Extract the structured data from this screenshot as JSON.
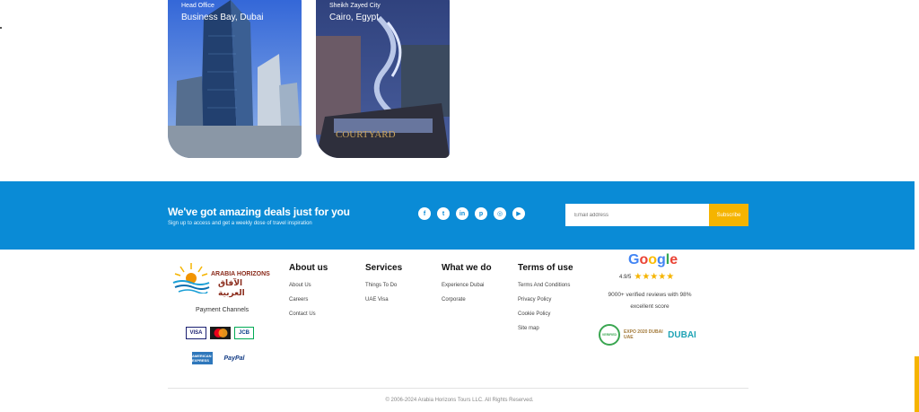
{
  "offices": [
    {
      "label": "Head Office",
      "city": "Business Bay, Dubai"
    },
    {
      "label": "Sheikh Zayed City",
      "city": "Cairo, Egypt"
    }
  ],
  "newsletter": {
    "title": "We've got amazing deals just for you",
    "subtitle": "Sign up to access and get a weekly dose of travel inspiration",
    "email_placeholder": "Email address",
    "subscribe_label": "Subscribe",
    "accent_color": "#0a8bd6",
    "button_color": "#f5b400"
  },
  "socials": [
    {
      "icon": "facebook-icon",
      "glyph": "f"
    },
    {
      "icon": "twitter-icon",
      "glyph": "t"
    },
    {
      "icon": "linkedin-icon",
      "glyph": "in"
    },
    {
      "icon": "pinterest-icon",
      "glyph": "p"
    },
    {
      "icon": "instagram-icon",
      "glyph": "◎"
    },
    {
      "icon": "youtube-icon",
      "glyph": "▶"
    }
  ],
  "brand": {
    "name_en": "ARABIA HORIZONS",
    "name_ar": "الآفاق العربية"
  },
  "payment": {
    "label": "Payment Channels",
    "methods": [
      "VISA",
      "mastercard",
      "JCB",
      "AMERICAN EXPRESS",
      "PayPal"
    ]
  },
  "columns": {
    "about": {
      "title": "About us",
      "links": [
        "About Us",
        "Careers",
        "Contact Us"
      ]
    },
    "services": {
      "title": "Services",
      "links": [
        "Things To Do",
        "UAE Visa"
      ]
    },
    "what": {
      "title": "What we do",
      "links": [
        "Experience Dubai",
        "Corporate"
      ]
    },
    "terms": {
      "title": "Terms of use",
      "links": [
        "Terms And Conditions",
        "Privacy Policy",
        "Cookie Policy",
        "Site map"
      ]
    }
  },
  "google": {
    "score": "4.9/5",
    "stars": "★★★★★",
    "reviews": "9000+ verified reviews with 98% excellent score"
  },
  "badges": [
    "VERIFIED",
    "EXPO 2020 DUBAI UAE",
    "DUBAI"
  ],
  "copyright": "© 2006-2024 Arabia Horizons Tours LLC. All Rights Reserved."
}
